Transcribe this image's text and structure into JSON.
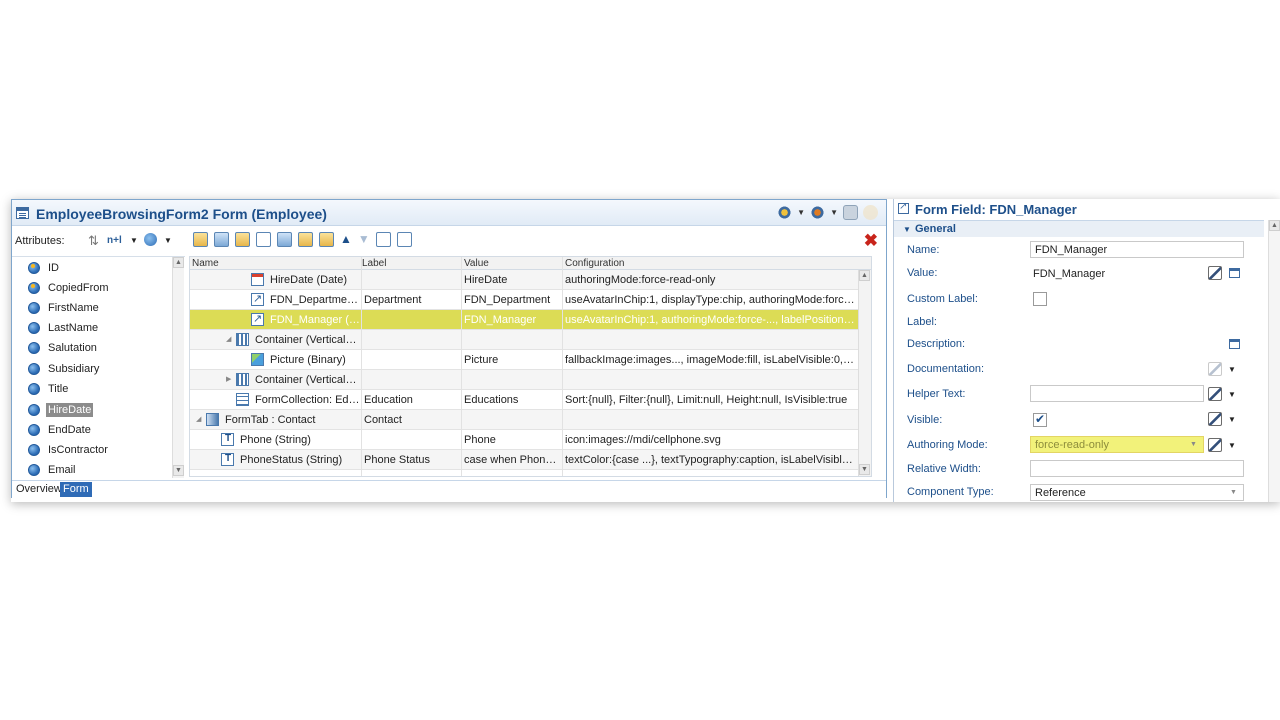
{
  "editor": {
    "title": "EmployeeBrowsingForm2 Form (Employee)",
    "attributes_label": "Attributes:",
    "nl_label": "n+l"
  },
  "attributes": [
    {
      "name": "ID",
      "selected": false
    },
    {
      "name": "CopiedFrom",
      "selected": false
    },
    {
      "name": "FirstName",
      "selected": false
    },
    {
      "name": "LastName",
      "selected": false
    },
    {
      "name": "Salutation",
      "selected": false
    },
    {
      "name": "Subsidiary",
      "selected": false
    },
    {
      "name": "Title",
      "selected": false
    },
    {
      "name": "HireDate",
      "selected": true
    },
    {
      "name": "EndDate",
      "selected": false
    },
    {
      "name": "IsContractor",
      "selected": false
    },
    {
      "name": "Email",
      "selected": false
    }
  ],
  "tabs": {
    "overview": "Overview",
    "form": "Form"
  },
  "grid": {
    "headers": {
      "name": "Name",
      "label": "Label",
      "value": "Value",
      "configuration": "Configuration"
    },
    "rows": [
      {
        "name": "HireDate (Date)",
        "label": "",
        "value": "HireDate",
        "configuration": "authoringMode:force-read-only"
      },
      {
        "name": "FDN_Department ...",
        "label": "Department",
        "value": "FDN_Department",
        "configuration": "useAvatarInChip:1, displayType:chip, authoringMode:force-..."
      },
      {
        "name": "FDN_Manager (St...",
        "label": "",
        "value": "FDN_Manager",
        "configuration": "useAvatarInChip:1, authoringMode:force-..., labelPosition:top, di..."
      },
      {
        "name": "Container (Vertical): ...",
        "label": "",
        "value": "",
        "configuration": ""
      },
      {
        "name": "Picture (Binary)",
        "label": "",
        "value": "Picture",
        "configuration": "fallbackImage:images..., imageMode:fill, isLabelVisible:0, image..."
      },
      {
        "name": "Container (Vertical): ...",
        "label": "",
        "value": "",
        "configuration": ""
      },
      {
        "name": "FormCollection: Educ...",
        "label": "Education",
        "value": "Educations",
        "configuration": "Sort:{null}, Filter:{null}, Limit:null, Height:null, IsVisible:true"
      },
      {
        "name": "FormTab : Contact",
        "label": "Contact",
        "value": "",
        "configuration": ""
      },
      {
        "name": "Phone (String)",
        "label": "",
        "value": "Phone",
        "configuration": "icon:images://mdi/cellphone.svg"
      },
      {
        "name": "PhoneStatus (String)",
        "label": "Phone Status",
        "value": "case  when Phone ...",
        "configuration": "textColor:{case ...}, textTypography:caption, isLabelVisible:0"
      }
    ]
  },
  "props": {
    "title": "Form Field: FDN_Manager",
    "section": "General",
    "name_label": "Name:",
    "name_value": "FDN_Manager",
    "value_label": "Value:",
    "value_value": "FDN_Manager",
    "custom_label_label": "Custom Label:",
    "custom_label_checked": false,
    "label_label": "Label:",
    "description_label": "Description:",
    "documentation_label": "Documentation:",
    "helper_text_label": "Helper Text:",
    "helper_text_value": "",
    "visible_label": "Visible:",
    "visible_checked": true,
    "authoring_mode_label": "Authoring Mode:",
    "authoring_mode_value": "force-read-only",
    "relative_width_label": "Relative Width:",
    "relative_width_value": "",
    "component_type_label": "Component Type:",
    "component_type_value": "Reference"
  },
  "colors": {
    "title": "#1d4f8a",
    "selection_highlight": "#dcdc55",
    "close": "#c8241b",
    "active_tab": "#2f6bb6"
  }
}
